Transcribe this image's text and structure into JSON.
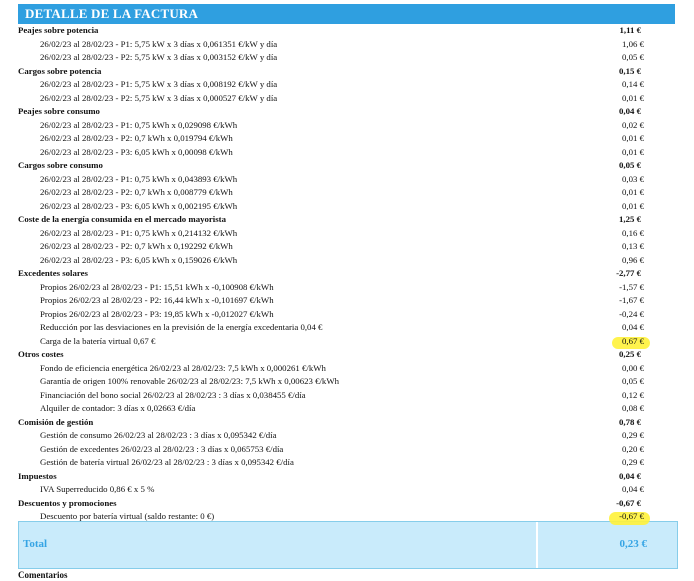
{
  "title": "DETALLE DE LA FACTURA",
  "rows": [
    {
      "type": "section",
      "label": "Peajes sobre potencia",
      "amount": "1,11 €"
    },
    {
      "type": "sub",
      "label": "26/02/23 al 28/02/23 - P1: 5,75 kW x 3 días x 0,061351 €/kW y día",
      "amount": "1,06 €"
    },
    {
      "type": "sub",
      "label": "26/02/23 al 28/02/23 - P2: 5,75 kW x 3 días x 0,003152 €/kW y día",
      "amount": "0,05 €"
    },
    {
      "type": "section",
      "label": "Cargos sobre potencia",
      "amount": "0,15 €"
    },
    {
      "type": "sub",
      "label": "26/02/23 al 28/02/23 - P1: 5,75 kW x 3 días x 0,008192 €/kW y día",
      "amount": "0,14 €"
    },
    {
      "type": "sub",
      "label": "26/02/23 al 28/02/23 - P2: 5,75 kW x 3 días x 0,000527 €/kW y día",
      "amount": "0,01 €"
    },
    {
      "type": "section",
      "label": "Peajes sobre consumo",
      "amount": "0,04 €"
    },
    {
      "type": "sub",
      "label": "26/02/23 al 28/02/23 - P1: 0,75 kWh x 0,029098 €/kWh",
      "amount": "0,02 €"
    },
    {
      "type": "sub",
      "label": "26/02/23 al 28/02/23 - P2: 0,7 kWh x 0,019794 €/kWh",
      "amount": "0,01 €"
    },
    {
      "type": "sub",
      "label": "26/02/23 al 28/02/23 - P3: 6,05 kWh x 0,00098 €/kWh",
      "amount": "0,01 €"
    },
    {
      "type": "section",
      "label": "Cargos sobre consumo",
      "amount": "0,05 €"
    },
    {
      "type": "sub",
      "label": "26/02/23 al 28/02/23 - P1: 0,75 kWh x 0,043893 €/kWh",
      "amount": "0,03 €"
    },
    {
      "type": "sub",
      "label": "26/02/23 al 28/02/23 - P2: 0,7 kWh x 0,008779 €/kWh",
      "amount": "0,01 €"
    },
    {
      "type": "sub",
      "label": "26/02/23 al 28/02/23 - P3: 6,05 kWh x 0,002195 €/kWh",
      "amount": "0,01 €"
    },
    {
      "type": "section",
      "label": "Coste de la energía consumida en el mercado mayorista",
      "amount": "1,25 €"
    },
    {
      "type": "sub",
      "label": "26/02/23 al 28/02/23 - P1: 0,75 kWh x 0,214132 €/kWh",
      "amount": "0,16 €"
    },
    {
      "type": "sub",
      "label": "26/02/23 al 28/02/23 - P2: 0,7 kWh x 0,192292 €/kWh",
      "amount": "0,13 €"
    },
    {
      "type": "sub",
      "label": "26/02/23 al 28/02/23 - P3: 6,05 kWh x 0,159026 €/kWh",
      "amount": "0,96 €"
    },
    {
      "type": "section",
      "label": "Excedentes solares",
      "amount": "-2,77 €"
    },
    {
      "type": "sub",
      "label": "Propios 26/02/23 al 28/02/23 - P1: 15,51 kWh x -0,100908 €/kWh",
      "amount": "-1,57 €"
    },
    {
      "type": "sub",
      "label": "Propios 26/02/23 al 28/02/23 - P2: 16,44 kWh x -0,101697 €/kWh",
      "amount": "-1,67 €"
    },
    {
      "type": "sub",
      "label": "Propios 26/02/23 al 28/02/23 - P3: 19,85 kWh x -0,012027 €/kWh",
      "amount": "-0,24 €"
    },
    {
      "type": "sub",
      "label": "Reducción por las desviaciones en la previsión de la energía excedentaria 0,04 €",
      "amount": "0,04 €"
    },
    {
      "type": "sub",
      "label": "Carga de la batería virtual 0,67 €",
      "amount": "0,67 €",
      "highlight": true
    },
    {
      "type": "section",
      "label": "Otros costes",
      "amount": "0,25 €"
    },
    {
      "type": "sub",
      "label": "Fondo de eficiencia energética 26/02/23 al 28/02/23: 7,5 kWh x 0,000261 €/kWh",
      "amount": "0,00 €"
    },
    {
      "type": "sub",
      "label": "Garantía de origen 100% renovable 26/02/23 al 28/02/23: 7,5 kWh x 0,00623 €/kWh",
      "amount": "0,05 €"
    },
    {
      "type": "sub",
      "label": "Financiación del bono social 26/02/23 al 28/02/23 : 3 días x 0,038455 €/día",
      "amount": "0,12 €"
    },
    {
      "type": "sub",
      "label": "Alquiler de contador: 3 días x 0,02663 €/día",
      "amount": "0,08 €"
    },
    {
      "type": "section",
      "label": "Comisión de gestión",
      "amount": "0,78 €"
    },
    {
      "type": "sub",
      "label": "Gestión de consumo 26/02/23 al 28/02/23 : 3 días x 0,095342 €/día",
      "amount": "0,29 €"
    },
    {
      "type": "sub",
      "label": "Gestión de excedentes 26/02/23 al 28/02/23 : 3 días x 0,065753 €/día",
      "amount": "0,20 €"
    },
    {
      "type": "sub",
      "label": "Gestión de batería virtual 26/02/23 al 28/02/23 : 3 días x 0,095342 €/día",
      "amount": "0,29 €"
    },
    {
      "type": "section",
      "label": "Impuestos",
      "amount": "0,04 €"
    },
    {
      "type": "sub",
      "label": "IVA Superreducido 0,86 € x 5 %",
      "amount": "0,04 €"
    },
    {
      "type": "section",
      "label": "Descuentos y promociones",
      "amount": "-0,67 €"
    },
    {
      "type": "sub",
      "label": "Descuento por batería virtual (saldo restante: 0 €)",
      "amount": "-0,67 €",
      "highlight": true
    }
  ],
  "total": {
    "label": "Total",
    "amount": "0,23 €"
  },
  "footer_heading": "Comentarios",
  "colors": {
    "header_bg": "#2f9fe0",
    "total_bg": "#c9ebfb",
    "total_text": "#35a4e4",
    "highlight": "#fff23a"
  }
}
